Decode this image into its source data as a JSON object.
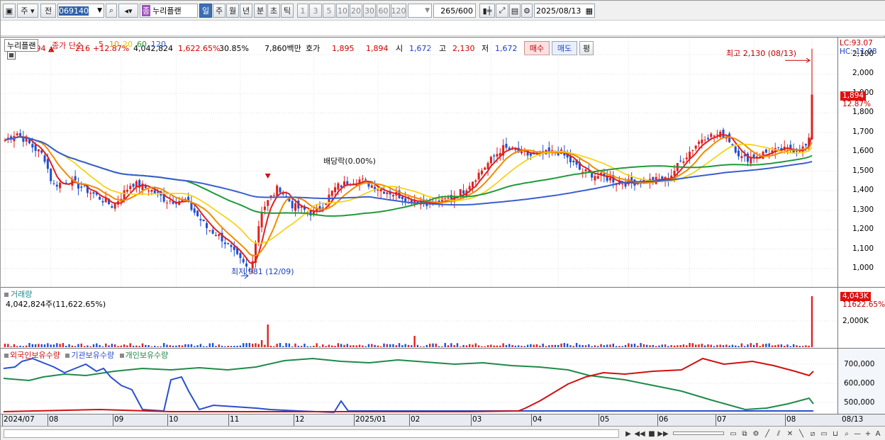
{
  "toolbar": {
    "market": "주",
    "scope": "전",
    "code": "069140",
    "badge": "종",
    "name": "누리플랜",
    "periods": [
      "일",
      "주",
      "월",
      "년",
      "분",
      "초",
      "틱"
    ],
    "active_period": "일",
    "intervals": [
      "1",
      "3",
      "5",
      "10",
      "20",
      "30",
      "60",
      "120"
    ],
    "count": "265",
    "count_total": "/600",
    "date": "2025/08/13"
  },
  "quote": {
    "price": "1,894",
    "change": "216",
    "rate": "+12.87%",
    "volume": "4,042,824",
    "vol_rate": "1,622.65%",
    "turnover": "30.85%",
    "amount": "7,860백만",
    "ask_label": "호가",
    "ask": "1,895",
    "bid": "1,894",
    "open_label": "시",
    "open": "1,672",
    "high_label": "고",
    "high": "2,130",
    "low_label": "저",
    "low": "1,672",
    "buy_label": "매수",
    "sell_label": "매도",
    "eval_label": "평"
  },
  "price_panel": {
    "name_tag": "누리플랜",
    "legend_prefix": "종가 단순",
    "ma": [
      {
        "label": "5",
        "color": "#e02020"
      },
      {
        "label": "10",
        "color": "#f08c00"
      },
      {
        "label": "20",
        "color": "#f5d000"
      },
      {
        "label": "60",
        "color": "#1e9a3a"
      },
      {
        "label": "120",
        "color": "#3a5fcd"
      }
    ],
    "high_note": "최고 2,130 (08/13)",
    "low_note": "최저 981 (12/09)",
    "dividend_note": "배당락(0.00%)",
    "lc": "LC:93.07",
    "hc": "HC:-11.08",
    "current_tag": "1,894",
    "current_rate": "12.87%",
    "ticks": [
      "2,100",
      "2,000",
      "1,900",
      "1,800",
      "1,700",
      "1,600",
      "1,500",
      "1,400",
      "1,300",
      "1,200",
      "1,100",
      "1,000"
    ]
  },
  "volume_panel": {
    "title": "거래량",
    "value_text": "4,042,824주(11,622.65%)",
    "tag": "4,043K",
    "tag_rate": "11622.65%",
    "tick": "2,000K"
  },
  "holding_panel": {
    "legend": [
      {
        "label": "외국인보유수량",
        "color": "#d01010"
      },
      {
        "label": "기관보유수량",
        "color": "#2a4fcf"
      },
      {
        "label": "개인보유수량",
        "color": "#1e8a4a"
      }
    ],
    "ticks": [
      "700,000",
      "600,000",
      "500,000"
    ]
  },
  "x_labels": [
    "2024/07",
    "08",
    "09",
    "10",
    "11",
    "12",
    "2025/01",
    "02",
    "03",
    "04",
    "05",
    "06",
    "07",
    "08"
  ],
  "x_right": "08/13",
  "colors": {
    "up": "#e02020",
    "down": "#2050d0",
    "active": "#3d6fb6"
  }
}
